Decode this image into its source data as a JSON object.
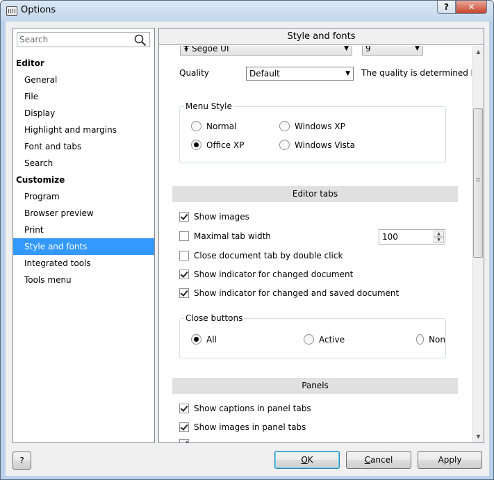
{
  "window": {
    "title": "Options",
    "help_label": "?",
    "close_label": "✕"
  },
  "search": {
    "placeholder": "Search"
  },
  "tree": [
    {
      "label": "Editor",
      "group": true
    },
    {
      "label": "General"
    },
    {
      "label": "File"
    },
    {
      "label": "Display"
    },
    {
      "label": "Highlight and margins"
    },
    {
      "label": "Font and tabs"
    },
    {
      "label": "Search"
    },
    {
      "label": "Customize",
      "group": true
    },
    {
      "label": "Program"
    },
    {
      "label": "Browser preview"
    },
    {
      "label": "Print"
    },
    {
      "label": "Style and fonts",
      "selected": true
    },
    {
      "label": "Integrated tools"
    },
    {
      "label": "Tools menu"
    }
  ],
  "panel": {
    "title": "Style and fonts",
    "font_combo": "Segoe UI",
    "size_combo": "9",
    "quality_label": "Quality",
    "quality_value": "Default",
    "quality_desc": "The quality is determined by t",
    "menu_style": {
      "title": "Menu Style",
      "options": [
        "Normal",
        "Windows XP",
        "Office XP",
        "Windows Vista"
      ],
      "selected": "Office XP"
    },
    "editor_tabs": {
      "title": "Editor tabs",
      "show_images": "Show images",
      "max_tab_width": "Maximal tab width",
      "max_tab_value": "100",
      "close_dblclick": "Close document tab by double click",
      "indicator_changed": "Show indicator for changed document",
      "indicator_saved": "Show indicator for changed and saved document"
    },
    "close_buttons": {
      "title": "Close buttons",
      "options": [
        "All",
        "Active",
        "Non"
      ],
      "selected": "All"
    },
    "panels": {
      "title": "Panels",
      "captions": "Show captions in panel tabs",
      "images": "Show images in panel tabs"
    }
  },
  "buttons": {
    "help": "?",
    "ok": "OK",
    "cancel": "Cancel",
    "apply": "Apply"
  }
}
